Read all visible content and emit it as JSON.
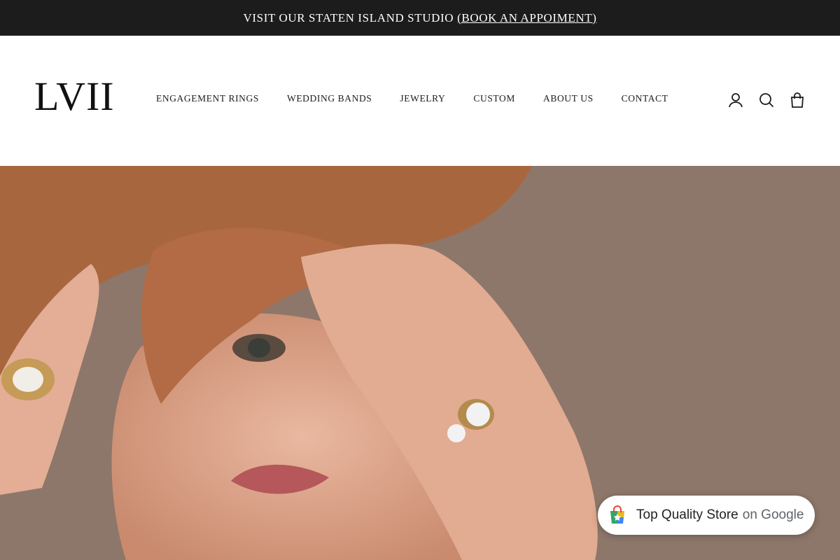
{
  "announcement": {
    "text": "VISIT OUR STATEN ISLAND STUDIO",
    "link_label": "(BOOK AN APPOIMENT)"
  },
  "header": {
    "logo": "LVII",
    "nav": [
      {
        "label": "ENGAGEMENT RINGS"
      },
      {
        "label": "WEDDING BANDS"
      },
      {
        "label": "JEWELRY"
      },
      {
        "label": "CUSTOM"
      },
      {
        "label": "ABOUT US"
      },
      {
        "label": "CONTACT"
      }
    ],
    "icons": [
      "account-icon",
      "search-icon",
      "cart-icon"
    ]
  },
  "hero": {
    "image": "woman-with-gold-rings-photo"
  },
  "google_badge": {
    "label": "Top Quality Store",
    "suffix": "on Google",
    "icon": "google-shopping-bag-icon"
  },
  "colors": {
    "announcement_bg": "#1c1c1c",
    "text": "#1c1c1c",
    "google_gray": "#5f6368"
  }
}
